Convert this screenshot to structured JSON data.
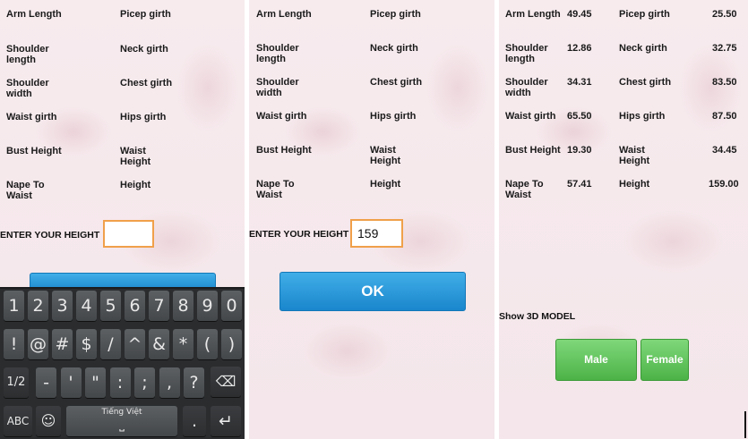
{
  "labels": {
    "arm_length": "Arm Length",
    "bicep_girth": "Picep girth",
    "shoulder_length": "Shoulder length",
    "neck_girth": "Neck girth",
    "shoulder_width": "Shoulder width",
    "chest_girth": "Chest girth",
    "waist_girth": "Waist girth",
    "hips_girth": "Hips girth",
    "bust_height": "Bust Height",
    "waist_height": "Waist Height",
    "nape_to_waist": "Nape To Waist",
    "height": "Height"
  },
  "results": {
    "arm_length": "49.45",
    "bicep_girth": "25.50",
    "shoulder_length": "12.86",
    "neck_girth": "32.75",
    "shoulder_width": "34.31",
    "chest_girth": "83.50",
    "waist_girth": "65.50",
    "hips_girth": "87.50",
    "bust_height": "19.30",
    "waist_height": "34.45",
    "nape_to_waist": "57.41",
    "height": "159.00"
  },
  "height_prompt": "ENTER YOUR HEIGHT",
  "screen1": {
    "height_value": ""
  },
  "screen2": {
    "height_value": "159"
  },
  "ok_label": "OK",
  "show_3d_label": "Show 3D MODEL",
  "male_label": "Male",
  "female_label": "Female",
  "keyboard": {
    "row1": [
      "1",
      "2",
      "3",
      "4",
      "5",
      "6",
      "7",
      "8",
      "9",
      "0"
    ],
    "row2": [
      "!",
      "@",
      "#",
      "$",
      "/",
      "^",
      "&",
      "*",
      "(",
      ")"
    ],
    "row3": [
      "1/2",
      "-",
      "'",
      "\"",
      ":",
      ";",
      ",",
      "?"
    ],
    "mode_key": "ABC",
    "space_label": "Tiếng Việt",
    "period_key": "."
  },
  "colors": {
    "ok_blue": "#1a86cc",
    "green": "#4cb347",
    "input_border": "#f0a04a"
  }
}
